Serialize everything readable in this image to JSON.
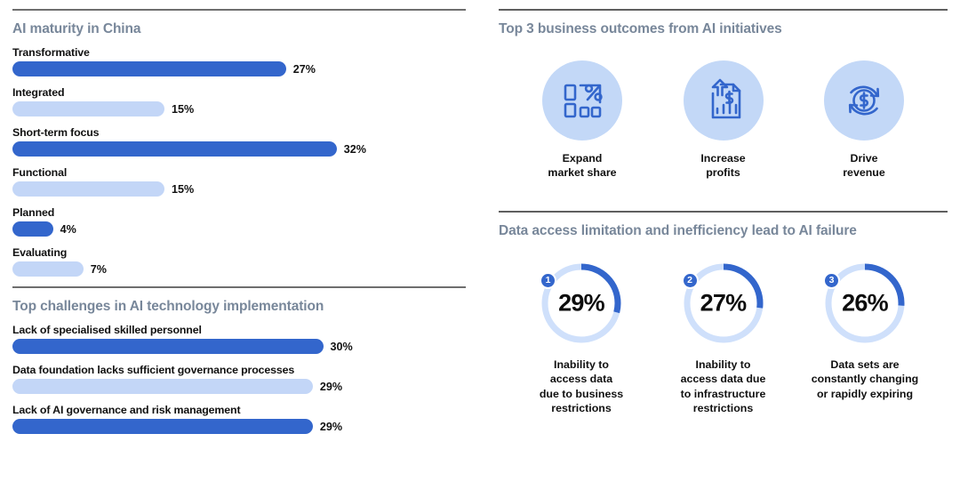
{
  "colors": {
    "accent_dark": "#3366cc",
    "accent_light": "#c3d6f7",
    "heading": "#78879a",
    "text": "#111111"
  },
  "left_column": {
    "maturity": {
      "title": "AI maturity in China",
      "bars": [
        {
          "label": "Transformative",
          "value": "27%",
          "pct": 27,
          "tone": "dark"
        },
        {
          "label": "Integrated",
          "value": "15%",
          "pct": 15,
          "tone": "light"
        },
        {
          "label": "Short-term focus",
          "value": "32%",
          "pct": 32,
          "tone": "dark"
        },
        {
          "label": "Functional",
          "value": "15%",
          "pct": 15,
          "tone": "light"
        },
        {
          "label": "Planned",
          "value": "4%",
          "pct": 4,
          "tone": "dark"
        },
        {
          "label": "Evaluating",
          "value": "7%",
          "pct": 7,
          "tone": "light"
        }
      ]
    },
    "challenges": {
      "title": "Top challenges in AI technology implementation",
      "bars": [
        {
          "label": "Lack of specialised skilled personnel",
          "value": "30%",
          "pct": 30,
          "tone": "dark"
        },
        {
          "label": "Data foundation lacks sufficient governance processes",
          "value": "29%",
          "pct": 29,
          "tone": "light"
        },
        {
          "label": "Lack of AI governance and risk management",
          "value": "29%",
          "pct": 29,
          "tone": "dark"
        }
      ]
    }
  },
  "right_column": {
    "outcomes": {
      "title": "Top 3 business outcomes from AI initiatives",
      "items": [
        {
          "icon": "market-share-percent-icon",
          "line1": "Expand",
          "line2": "market share"
        },
        {
          "icon": "document-growth-dollar-icon",
          "line1": "Increase",
          "line2": "profits"
        },
        {
          "icon": "recycle-dollar-coin-icon",
          "line1": "Drive",
          "line2": "revenue"
        }
      ]
    },
    "failures": {
      "title": "Data access limitation and inefficiency lead to AI failure",
      "items": [
        {
          "rank": "1",
          "value": "29%",
          "pct": 29,
          "label": "Inability to\naccess data\ndue to business\nrestrictions"
        },
        {
          "rank": "2",
          "value": "27%",
          "pct": 27,
          "label": "Inability to\naccess data due\nto infrastructure\nrestrictions"
        },
        {
          "rank": "3",
          "value": "26%",
          "pct": 26,
          "label": "Data sets are\nconstantly changing\nor rapidly expiring"
        }
      ]
    }
  },
  "chart_data": [
    {
      "type": "bar",
      "title": "AI maturity in China",
      "orientation": "horizontal",
      "categories": [
        "Transformative",
        "Integrated",
        "Short-term focus",
        "Functional",
        "Planned",
        "Evaluating"
      ],
      "values": [
        27,
        15,
        32,
        15,
        4,
        7
      ],
      "unit": "%",
      "xlabel": "",
      "ylabel": "",
      "xlim": [
        0,
        32
      ],
      "grid": false,
      "legend": false
    },
    {
      "type": "bar",
      "title": "Top challenges in AI technology implementation",
      "orientation": "horizontal",
      "categories": [
        "Lack of specialised skilled personnel",
        "Data foundation lacks sufficient governance processes",
        "Lack of AI governance and risk management"
      ],
      "values": [
        30,
        29,
        29
      ],
      "unit": "%",
      "xlabel": "",
      "ylabel": "",
      "xlim": [
        0,
        30
      ],
      "grid": false,
      "legend": false
    },
    {
      "type": "pie",
      "subtype": "donut",
      "title": "Data access limitation and inefficiency lead to AI failure",
      "categories": [
        "Inability to access data due to business restrictions",
        "Inability to access data due to infrastructure restrictions",
        "Data sets are constantly changing or rapidly expiring"
      ],
      "values": [
        29,
        27,
        26
      ],
      "unit": "%",
      "grid": false,
      "legend": false
    }
  ]
}
